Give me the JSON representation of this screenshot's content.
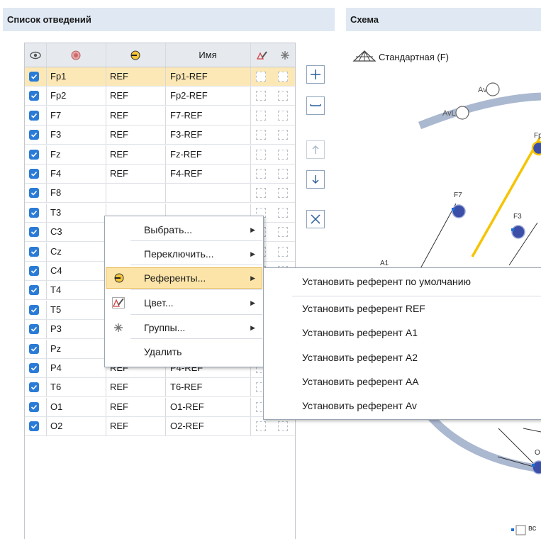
{
  "left_panel": {
    "title": "Список отведений"
  },
  "right_panel": {
    "title": "Схема",
    "scheme_name": "Стандартная (F)",
    "footer_label": "вс"
  },
  "table": {
    "headers": {
      "eye_icon": "eye-icon",
      "active_icon": "active-electrode-icon",
      "ref_icon": "reference-electrode-icon",
      "name": "Имя",
      "color_icon": "color-pen-icon",
      "group_icon": "snowflake-icon"
    },
    "rows": [
      {
        "checked": true,
        "active": "Fp1",
        "ref": "REF",
        "name": "Fp1-REF",
        "selected": true
      },
      {
        "checked": true,
        "active": "Fp2",
        "ref": "REF",
        "name": "Fp2-REF"
      },
      {
        "checked": true,
        "active": "F7",
        "ref": "REF",
        "name": "F7-REF"
      },
      {
        "checked": true,
        "active": "F3",
        "ref": "REF",
        "name": "F3-REF"
      },
      {
        "checked": true,
        "active": "Fz",
        "ref": "REF",
        "name": "Fz-REF"
      },
      {
        "checked": true,
        "active": "F4",
        "ref": "REF",
        "name": "F4-REF"
      },
      {
        "checked": true,
        "active": "F8",
        "ref": "",
        "name": ""
      },
      {
        "checked": true,
        "active": "T3",
        "ref": "",
        "name": ""
      },
      {
        "checked": true,
        "active": "C3",
        "ref": "",
        "name": ""
      },
      {
        "checked": true,
        "active": "Cz",
        "ref": "",
        "name": ""
      },
      {
        "checked": true,
        "active": "C4",
        "ref": "",
        "name": ""
      },
      {
        "checked": true,
        "active": "T4",
        "ref": "",
        "name": ""
      },
      {
        "checked": true,
        "active": "T5",
        "ref": "",
        "name": ""
      },
      {
        "checked": true,
        "active": "P3",
        "ref": "REF",
        "name": "P3-REF"
      },
      {
        "checked": true,
        "active": "Pz",
        "ref": "REF",
        "name": "Pz-REF"
      },
      {
        "checked": true,
        "active": "P4",
        "ref": "REF",
        "name": "P4-REF"
      },
      {
        "checked": true,
        "active": "T6",
        "ref": "REF",
        "name": "T6-REF"
      },
      {
        "checked": true,
        "active": "O1",
        "ref": "REF",
        "name": "O1-REF"
      },
      {
        "checked": true,
        "active": "O2",
        "ref": "REF",
        "name": "O2-REF"
      }
    ]
  },
  "toolbar": {
    "add": "plus-icon",
    "remove": "minus-icon",
    "up": "arrow-up-icon",
    "down": "arrow-down-icon",
    "delete": "close-icon"
  },
  "context_menu": {
    "items": [
      {
        "label": "Выбрать...",
        "submenu": true
      },
      {
        "label": "Переключить...",
        "submenu": true
      },
      {
        "label": "Референты...",
        "submenu": true,
        "highlighted": true,
        "icon": "reference-electrode-icon"
      },
      {
        "label": "Цвет...",
        "submenu": true,
        "icon": "color-pen-icon"
      },
      {
        "label": "Группы...",
        "submenu": true,
        "icon": "snowflake-icon"
      },
      {
        "label": "Удалить",
        "submenu": false
      }
    ]
  },
  "submenu": {
    "items": [
      "Установить референт по умолчанию",
      "Установить референт REF",
      "Установить референт A1",
      "Установить референт A2",
      "Установить референт AA",
      "Установить референт Av"
    ]
  },
  "scheme": {
    "electrodes": [
      "Av",
      "AvL",
      "Fp",
      "F7",
      "F3",
      "A1",
      "O"
    ]
  },
  "colors": {
    "accent": "#2a7bd6",
    "selection": "#fce8b6",
    "highlight": "#fce4a8",
    "link_line": "#f5c400",
    "head": "#aab8d0"
  }
}
